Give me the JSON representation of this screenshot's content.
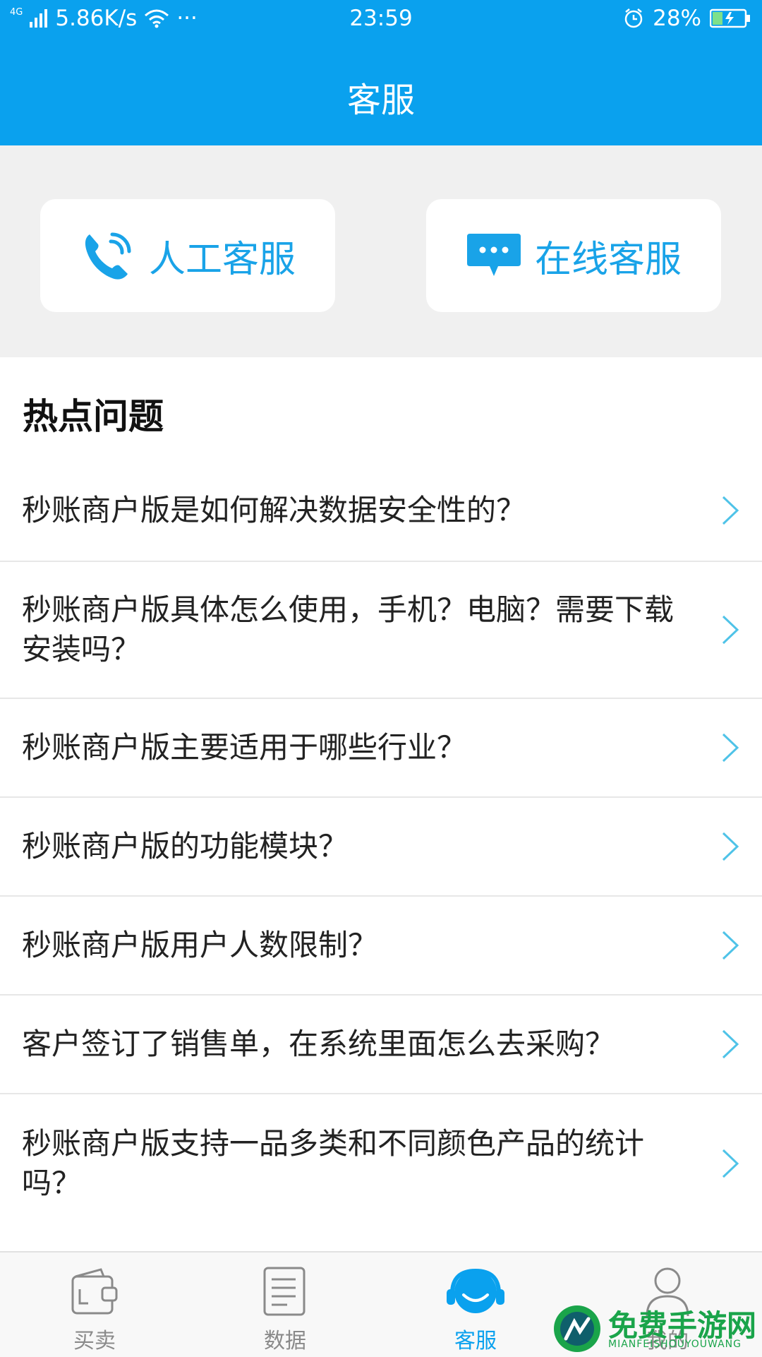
{
  "status_bar": {
    "network": "4G",
    "speed": "5.86K/s",
    "more": "···",
    "time": "23:59",
    "battery": "28%"
  },
  "header": {
    "title": "客服"
  },
  "service_buttons": [
    {
      "label": "人工客服",
      "icon": "phone-icon"
    },
    {
      "label": "在线客服",
      "icon": "chat-bubble-icon"
    }
  ],
  "hot_questions": {
    "title": "热点问题",
    "items": [
      "秒账商户版是如何解决数据安全性的？",
      "秒账商户版具体怎么使用，手机？电脑？需要下载安装吗？",
      "秒账商户版主要适用于哪些行业？",
      "秒账商户版的功能模块？",
      "秒账商户版用户人数限制？",
      "客户签订了销售单，在系统里面怎么去采购？",
      "秒账商户版支持一品多类和不同颜色产品的统计吗？"
    ]
  },
  "tabs": [
    {
      "label": "买卖",
      "icon": "wallet-icon",
      "active": false
    },
    {
      "label": "数据",
      "icon": "document-icon",
      "active": false
    },
    {
      "label": "客服",
      "icon": "headset-icon",
      "active": true
    },
    {
      "label": "我的",
      "icon": "person-icon",
      "active": false
    }
  ],
  "watermark": {
    "title": "免费手游网",
    "subtitle": "MIANFEISHOUYOUWANG"
  },
  "colors": {
    "primary": "#0aa1ee",
    "accent_text": "#19a3e8",
    "chevron": "#4fc3e8"
  }
}
